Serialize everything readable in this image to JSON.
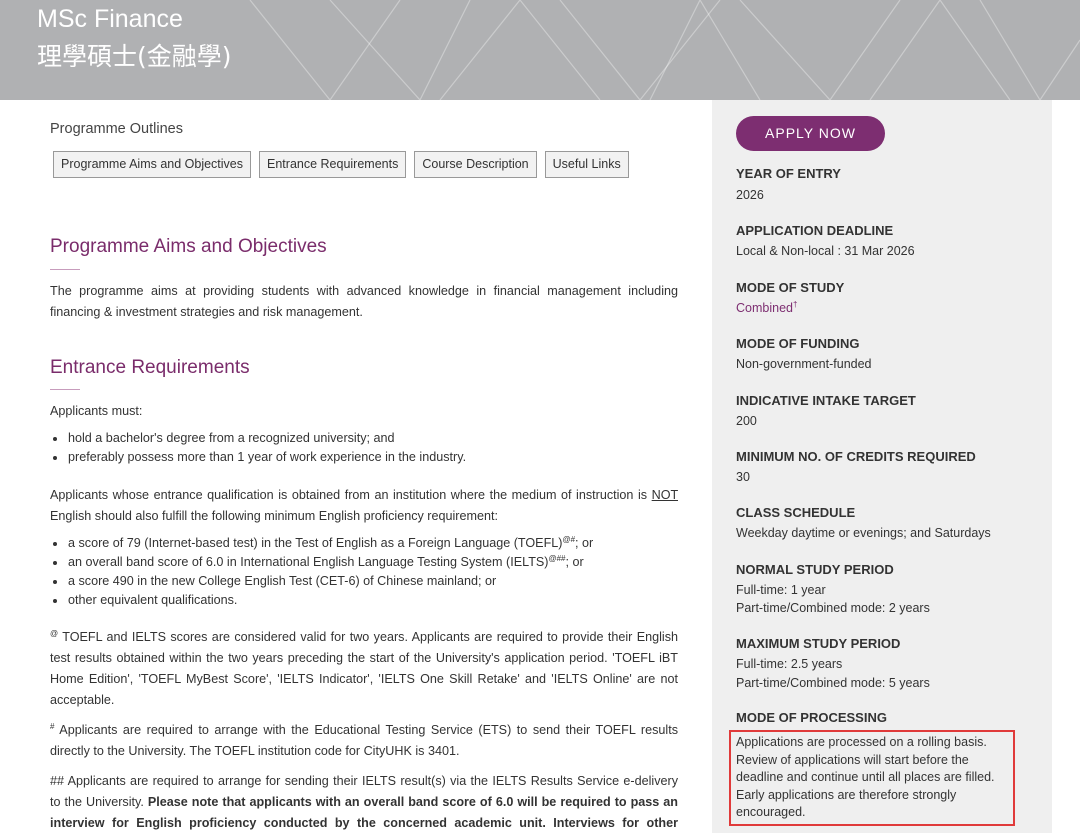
{
  "header": {
    "title": "MSc Finance",
    "subtitle": "理學碩士(金融學)"
  },
  "outlines": {
    "label": "Programme Outlines",
    "tabs": [
      "Programme Aims and Objectives",
      "Entrance Requirements",
      "Course Description",
      "Useful Links"
    ]
  },
  "aims": {
    "heading": "Programme Aims and Objectives",
    "text": "The programme aims at providing students with advanced knowledge in financial management including financing & investment strategies and risk management."
  },
  "entrance": {
    "heading": "Entrance Requirements",
    "intro": "Applicants must:",
    "must": [
      "hold a bachelor's degree from a recognized university; and",
      "preferably possess more than 1 year of work experience in the industry."
    ],
    "medium_before": "Applicants whose entrance qualification is obtained from an institution where the medium of instruction is ",
    "medium_not": "NOT",
    "medium_after": " English should also fulfill the following minimum English proficiency requirement:",
    "english": [
      {
        "text": "a score of 79 (Internet-based test) in the Test of English as a Foreign Language (TOEFL)",
        "sup": "@#",
        "tail": "; or"
      },
      {
        "text": "an overall band score of 6.0 in International English Language Testing System (IELTS)",
        "sup": "@##",
        "tail": "; or"
      },
      {
        "text": "a score 490 in the new College English Test (CET-6) of Chinese mainland; or",
        "sup": "",
        "tail": ""
      },
      {
        "text": "other equivalent qualifications.",
        "sup": "",
        "tail": ""
      }
    ],
    "note1_mark": "@",
    "note1": " TOEFL and IELTS scores are considered valid for two years. Applicants are required to provide their English test results obtained within the two years preceding the start of the University's application period. 'TOEFL iBT Home Edition', 'TOEFL MyBest Score', 'IELTS Indicator', 'IELTS One Skill Retake' and 'IELTS Online' are not acceptable.",
    "note2_mark": "#",
    "note2": " Applicants are required to arrange with the Educational Testing Service (ETS) to send their TOEFL results directly to the University. The TOEFL institution code for CityUHK is 3401.",
    "note3": "## Applicants are required to arrange for sending their IELTS result(s) via the IELTS Results Service e-delivery to the University. ",
    "note3_bold": "Please note that applicants with an overall band score of 6.0 will be required to pass an interview for English proficiency conducted by the concerned academic unit. Interviews for other applicants"
  },
  "sidebar": {
    "apply_label": "APPLY NOW",
    "year_label": "YEAR OF ENTRY",
    "year_value": "2026",
    "deadline_label": "APPLICATION DEADLINE",
    "deadline_value": "Local & Non-local : 31 Mar 2026",
    "mode_label": "MODE OF STUDY",
    "mode_value": "Combined",
    "mode_mark": "†",
    "funding_label": "MODE OF FUNDING",
    "funding_value": "Non-government-funded",
    "intake_label": "INDICATIVE INTAKE TARGET",
    "intake_value": "200",
    "credits_label": "MINIMUM NO. OF CREDITS REQUIRED",
    "credits_value": "30",
    "schedule_label": "CLASS SCHEDULE",
    "schedule_value": "Weekday daytime or evenings; and Saturdays",
    "normal_label": "NORMAL STUDY PERIOD",
    "normal_line1": "Full-time: 1 year",
    "normal_line2": "Part-time/Combined mode: 2 years",
    "max_label": "MAXIMUM STUDY PERIOD",
    "max_line1": "Full-time: 2.5 years",
    "max_line2": "Part-time/Combined mode: 5 years",
    "processing_label": "MODE OF PROCESSING",
    "processing_text": "Applications are processed on a rolling basis. Review of applications will start before the deadline and continue until all places are filled. Early applications are therefore strongly encouraged."
  },
  "colors": {
    "accent": "#7d2e71",
    "highlight_border": "#e03a3a",
    "sidebar_bg": "#efefef"
  }
}
